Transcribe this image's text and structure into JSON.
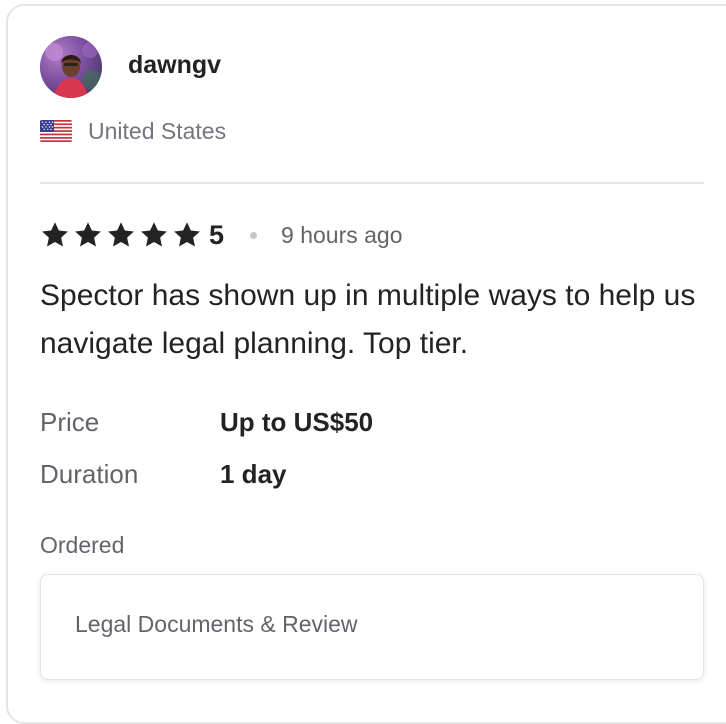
{
  "review": {
    "username": "dawngv",
    "avatar_icon": "user-avatar-photo",
    "country": "United States",
    "flag_icon": "us-flag-icon",
    "star_icon": "star-icon",
    "star_color": "#222325",
    "rating_value": "5",
    "rating_stars": 5,
    "time_ago": "9 hours ago",
    "text": "Spector has shown up in multiple ways to help us navigate legal planning. Top tier."
  },
  "details": {
    "price_label": "Price",
    "price_value": "Up to US$50",
    "duration_label": "Duration",
    "duration_value": "1 day"
  },
  "ordered": {
    "label": "Ordered",
    "item": "Legal Documents & Review"
  },
  "colors": {
    "primary_text": "#222325",
    "secondary_text": "#62646a",
    "border": "#e4e5e7"
  }
}
